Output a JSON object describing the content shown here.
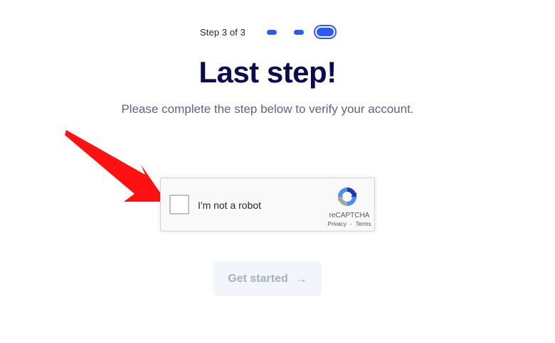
{
  "stepper": {
    "label": "Step 3 of 3",
    "current_step": 3,
    "total_steps": 3,
    "accent_color": "#2a5bf6"
  },
  "heading": {
    "title": "Last step!",
    "subtitle": "Please complete the step below to verify your account."
  },
  "annotation": {
    "icon": "red-arrow-icon",
    "color": "#ff0000"
  },
  "captcha": {
    "checkbox_label": "I'm not a robot",
    "checked": false,
    "brand": "reCAPTCHA",
    "privacy_link": "Privacy",
    "separator": "-",
    "terms_link": "Terms",
    "icon": "recaptcha-logo-icon"
  },
  "cta": {
    "label": "Get started",
    "icon": "arrow-right-icon",
    "arrow_glyph": "→",
    "disabled": true
  }
}
